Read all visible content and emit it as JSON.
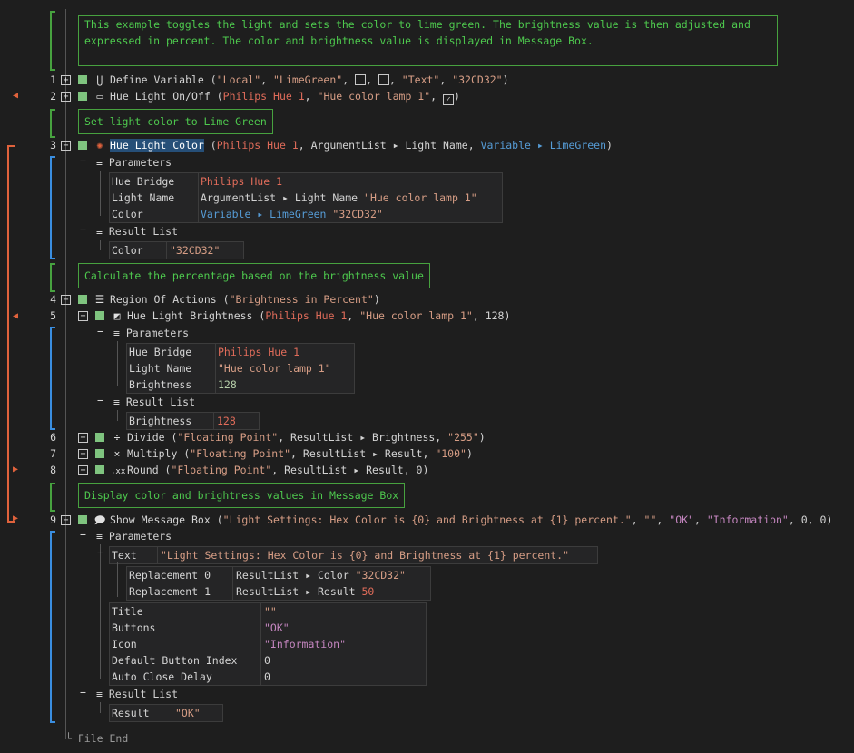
{
  "comments": [
    "This example toggles the light and sets the color to lime green. The brightness value is then adjusted and expressed in percent. The color and brightness value is displayed in Message Box.",
    "Set light color to Lime Green",
    "Calculate the percentage based on the brightness value",
    "Display color and brightness values in Message Box"
  ],
  "lines": [
    {
      "num": "1",
      "name": "Define Variable",
      "icon": "variable-icon"
    },
    {
      "num": "2",
      "name": "Hue Light On/Off",
      "icon": "toggle-icon"
    },
    {
      "num": "3",
      "name": "Hue Light Color",
      "icon": "color-wheel-icon"
    },
    {
      "num": "4",
      "name": "Region Of Actions",
      "icon": "region-icon"
    },
    {
      "num": "5",
      "name": "Hue Light Brightness",
      "icon": "brightness-icon"
    },
    {
      "num": "6",
      "name": "Divide",
      "icon": "divide-icon"
    },
    {
      "num": "7",
      "name": "Multiply",
      "icon": "multiply-icon"
    },
    {
      "num": "8",
      "name": "Round",
      "icon": "round-icon"
    },
    {
      "num": "9",
      "name": "Show Message Box",
      "icon": "message-box-icon"
    }
  ],
  "args": {
    "l1": {
      "a": "\"Local\"",
      "b": "\"LimeGreen\"",
      "c": "\"Text\"",
      "d": "\"32CD32\""
    },
    "l2": {
      "a": "Philips Hue 1",
      "b": "\"Hue color lamp 1\""
    },
    "l3": {
      "a": "Philips Hue 1",
      "b": "ArgumentList ▸ Light Name",
      "c": "Variable ▸ LimeGreen"
    },
    "l4": {
      "a": "\"Brightness in Percent\""
    },
    "l5": {
      "a": "Philips Hue 1",
      "b": "\"Hue color lamp 1\"",
      "c": "128"
    },
    "l6": {
      "a": "\"Floating Point\"",
      "b": "ResultList ▸ Brightness",
      "c": "\"255\""
    },
    "l7": {
      "a": "\"Floating Point\"",
      "b": "ResultList ▸ Result",
      "c": "\"100\""
    },
    "l8": {
      "a": "\"Floating Point\"",
      "b": "ResultList ▸ Result",
      "c": "0"
    },
    "l9": {
      "a": "\"Light Settings: Hex Color is {0} and Brightness at {1} percent.\"",
      "b": "\"\"",
      "c": "\"OK\"",
      "d": "\"Information\"",
      "e": "0",
      "f": "0"
    }
  },
  "labels": {
    "parameters": "Parameters",
    "result_list": "Result List",
    "file_end": "File End"
  },
  "p3": [
    {
      "k": "Hue Bridge",
      "v": "Philips Hue 1"
    },
    {
      "k": "Light Name",
      "v": "ArgumentList ▸ Light Name",
      "v2": "\"Hue color lamp 1\""
    },
    {
      "k": "Color",
      "v": "Variable ▸ LimeGreen",
      "v2": "\"32CD32\""
    }
  ],
  "r3": {
    "k": "Color",
    "v": "\"32CD32\""
  },
  "p5": [
    {
      "k": "Hue Bridge",
      "v": "Philips Hue 1"
    },
    {
      "k": "Light Name",
      "v": "\"Hue color lamp 1\""
    },
    {
      "k": "Brightness",
      "v": "128"
    }
  ],
  "r5": {
    "k": "Brightness",
    "v": "128"
  },
  "p9": {
    "text_k": "Text",
    "text_v": "\"Light Settings: Hex Color is {0} and Brightness at {1} percent.\"",
    "rep": [
      {
        "k": "Replacement 0",
        "v": "ResultList ▸ Color",
        "v2": "\"32CD32\""
      },
      {
        "k": "Replacement 1",
        "v": "ResultList ▸ Result",
        "v2": "50"
      }
    ],
    "rows": [
      {
        "k": "Title",
        "v": "\"\""
      },
      {
        "k": "Buttons",
        "v": "\"OK\""
      },
      {
        "k": "Icon",
        "v": "\"Information\""
      },
      {
        "k": "Default Button Index",
        "v": "0"
      },
      {
        "k": "Auto Close Delay",
        "v": "0"
      }
    ]
  },
  "r9": {
    "k": "Result",
    "v": "\"OK\""
  },
  "colors": {
    "accent": "#3a8ee0",
    "comment": "#4ec94e",
    "marker": "#e0623c",
    "string": "#d69d85",
    "variable": "#569cd6",
    "number": "#e06c5a"
  }
}
